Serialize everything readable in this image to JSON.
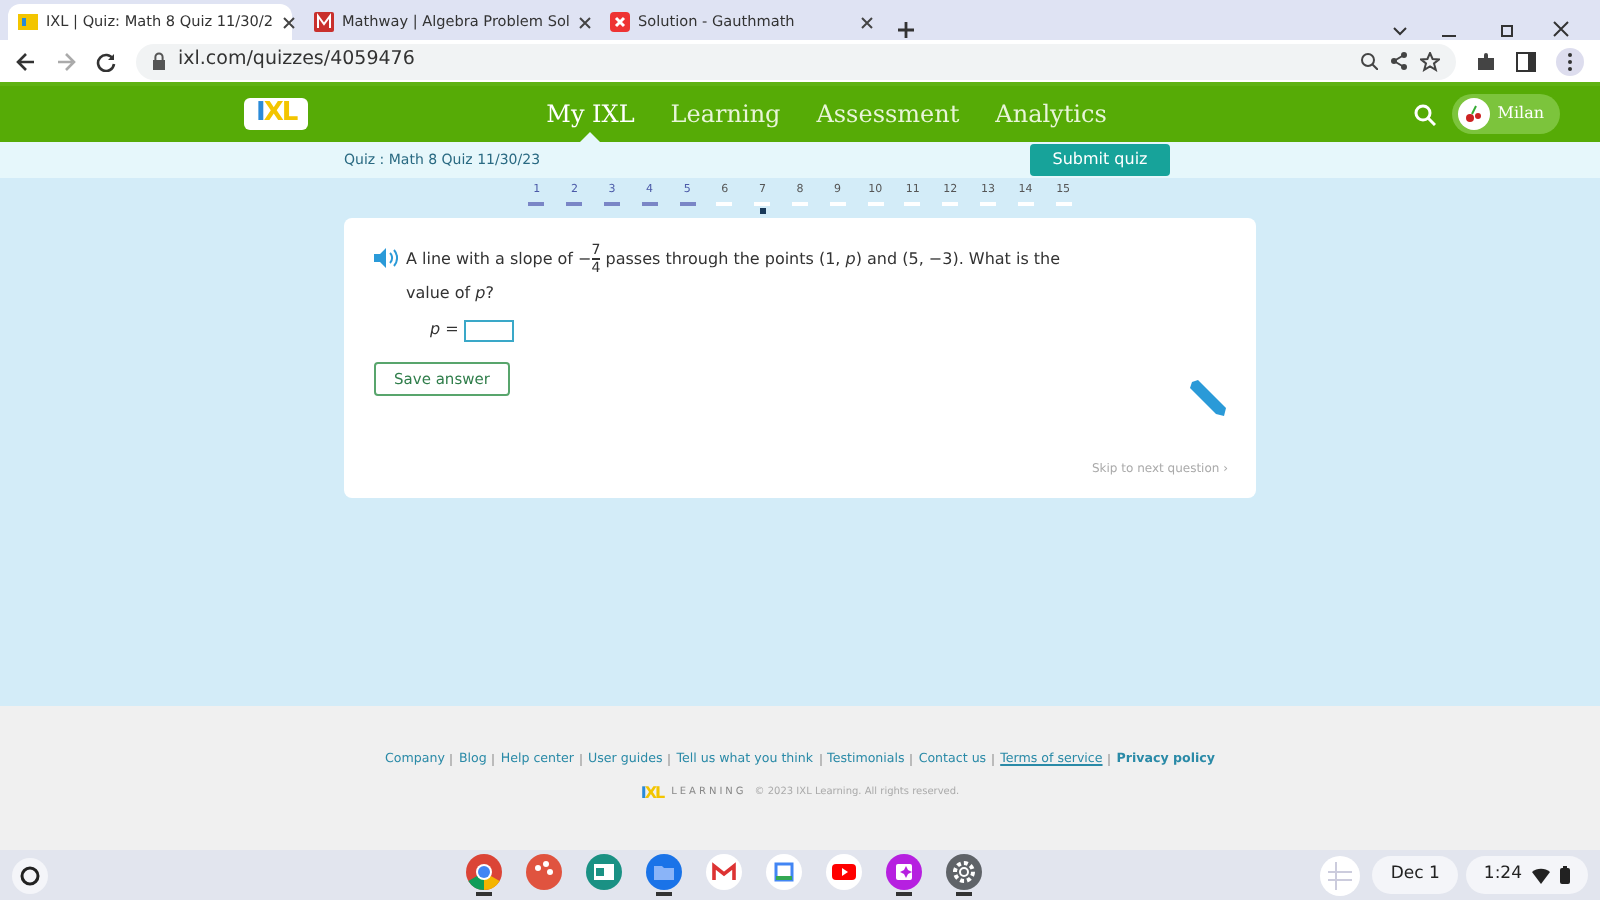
{
  "browser": {
    "tabs": [
      {
        "title": "IXL | Quiz: Math 8 Quiz 11/30/2",
        "selected": true
      },
      {
        "title": "Mathway | Algebra Problem Sol",
        "selected": false
      },
      {
        "title": "Solution - Gauthmath",
        "selected": false
      }
    ],
    "address": "ixl.com/quizzes/4059476"
  },
  "site_nav": {
    "logo": "IXL",
    "items": [
      {
        "label": "My IXL",
        "selected": true
      },
      {
        "label": "Learning",
        "selected": false
      },
      {
        "label": "Assessment",
        "selected": false
      },
      {
        "label": "Analytics",
        "selected": false
      }
    ],
    "user": "Milan"
  },
  "quiz_bar": {
    "title": "Quiz : Math 8 Quiz 11/30/23",
    "submit": "Submit quiz"
  },
  "questions": [
    {
      "number": "1",
      "answered": true,
      "selected": false
    },
    {
      "number": "2",
      "answered": true,
      "selected": false
    },
    {
      "number": "3",
      "answered": true,
      "selected": false
    },
    {
      "number": "4",
      "answered": true,
      "selected": false
    },
    {
      "number": "5",
      "answered": true,
      "selected": false
    },
    {
      "number": "6",
      "answered": false,
      "selected": false
    },
    {
      "number": "7",
      "answered": false,
      "selected": true
    },
    {
      "number": "8",
      "answered": false,
      "selected": false
    },
    {
      "number": "9",
      "answered": false,
      "selected": false
    },
    {
      "number": "10",
      "answered": false,
      "selected": false
    },
    {
      "number": "11",
      "answered": false,
      "selected": false
    },
    {
      "number": "12",
      "answered": false,
      "selected": false
    },
    {
      "number": "13",
      "answered": false,
      "selected": false
    },
    {
      "number": "14",
      "answered": false,
      "selected": false
    },
    {
      "number": "15",
      "answered": false,
      "selected": false
    }
  ],
  "question": {
    "text_before": "A line with a slope of",
    "fraction": {
      "sign": "−",
      "numerator": "7",
      "denominator": "4"
    },
    "text_after": "passes through the points (1, *p*) and (5, −3). What is the value of *p*?",
    "answer_label": "*p* =",
    "save": "Save answer",
    "skip": "Skip to next question ›"
  },
  "footer": {
    "links": [
      {
        "label": "Company",
        "kind": "plain"
      },
      {
        "label": "Blog",
        "kind": "plain"
      },
      {
        "label": "Help center",
        "kind": "plain"
      },
      {
        "label": "User guides",
        "kind": "plain"
      },
      {
        "label": "Tell us what you think",
        "kind": "plain"
      },
      {
        "label": "Testimonials",
        "kind": "plain"
      },
      {
        "label": "Contact us",
        "kind": "plain"
      },
      {
        "label": "Terms of service",
        "kind": "underlined"
      },
      {
        "label": "Privacy policy",
        "kind": "bold"
      }
    ],
    "logo": "IXL",
    "logo_word": "LEARNING",
    "copyright": "© 2023 IXL Learning. All rights reserved."
  },
  "taskbar": {
    "apps": [
      {
        "running": true
      },
      {
        "running": false
      },
      {
        "running": false
      },
      {
        "running": true
      },
      {
        "running": false
      },
      {
        "running": false
      },
      {
        "running": false
      },
      {
        "running": true
      },
      {
        "running": true
      }
    ],
    "date": "Dec 1",
    "time": "1:24"
  }
}
